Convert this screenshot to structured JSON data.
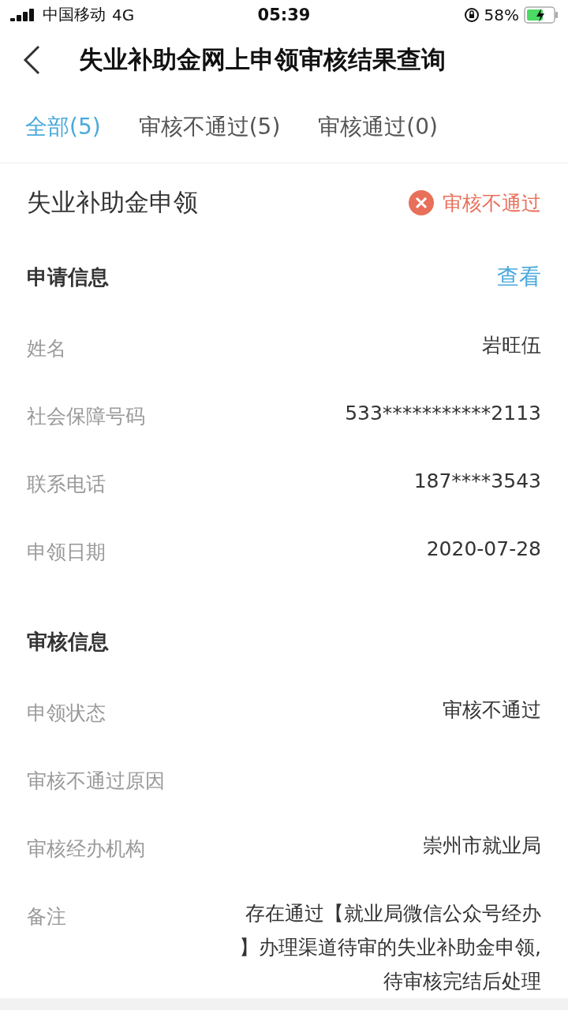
{
  "status_bar": {
    "carrier": "中国移动",
    "network": "4G",
    "time": "05:39",
    "battery": "58%"
  },
  "nav": {
    "title": "失业补助金网上申领审核结果查询"
  },
  "tabs": [
    {
      "label": "全部(5)",
      "selected": true
    },
    {
      "label": "审核不通过(5)",
      "selected": false
    },
    {
      "label": "审核通过(0)",
      "selected": false
    }
  ],
  "card": {
    "title": "失业补助金申领",
    "status": {
      "kind": "rejected",
      "label": "审核不通过"
    },
    "sections": [
      {
        "title": "申请信息",
        "action": "查看",
        "rows": [
          {
            "label": "姓名",
            "value": [
              "岩旺伍"
            ]
          },
          {
            "label": "社会保障号码",
            "value": [
              "533***********2113"
            ]
          },
          {
            "label": "联系电话",
            "value": [
              "187****3543"
            ]
          },
          {
            "label": "申领日期",
            "value": [
              "2020-07-28"
            ]
          }
        ]
      },
      {
        "title": "审核信息",
        "rows": [
          {
            "label": "申领状态",
            "value": [
              "审核不通过"
            ]
          },
          {
            "label": "审核不通过原因"
          },
          {
            "label": "审核经办机构",
            "value": [
              "崇州市就业局"
            ]
          },
          {
            "label": "备注",
            "value": [
              "存在通过【就业局微信公众号经办",
              "】办理渠道待审的失业补助金申领,",
              "待审核完结后处理"
            ]
          }
        ]
      }
    ]
  }
}
